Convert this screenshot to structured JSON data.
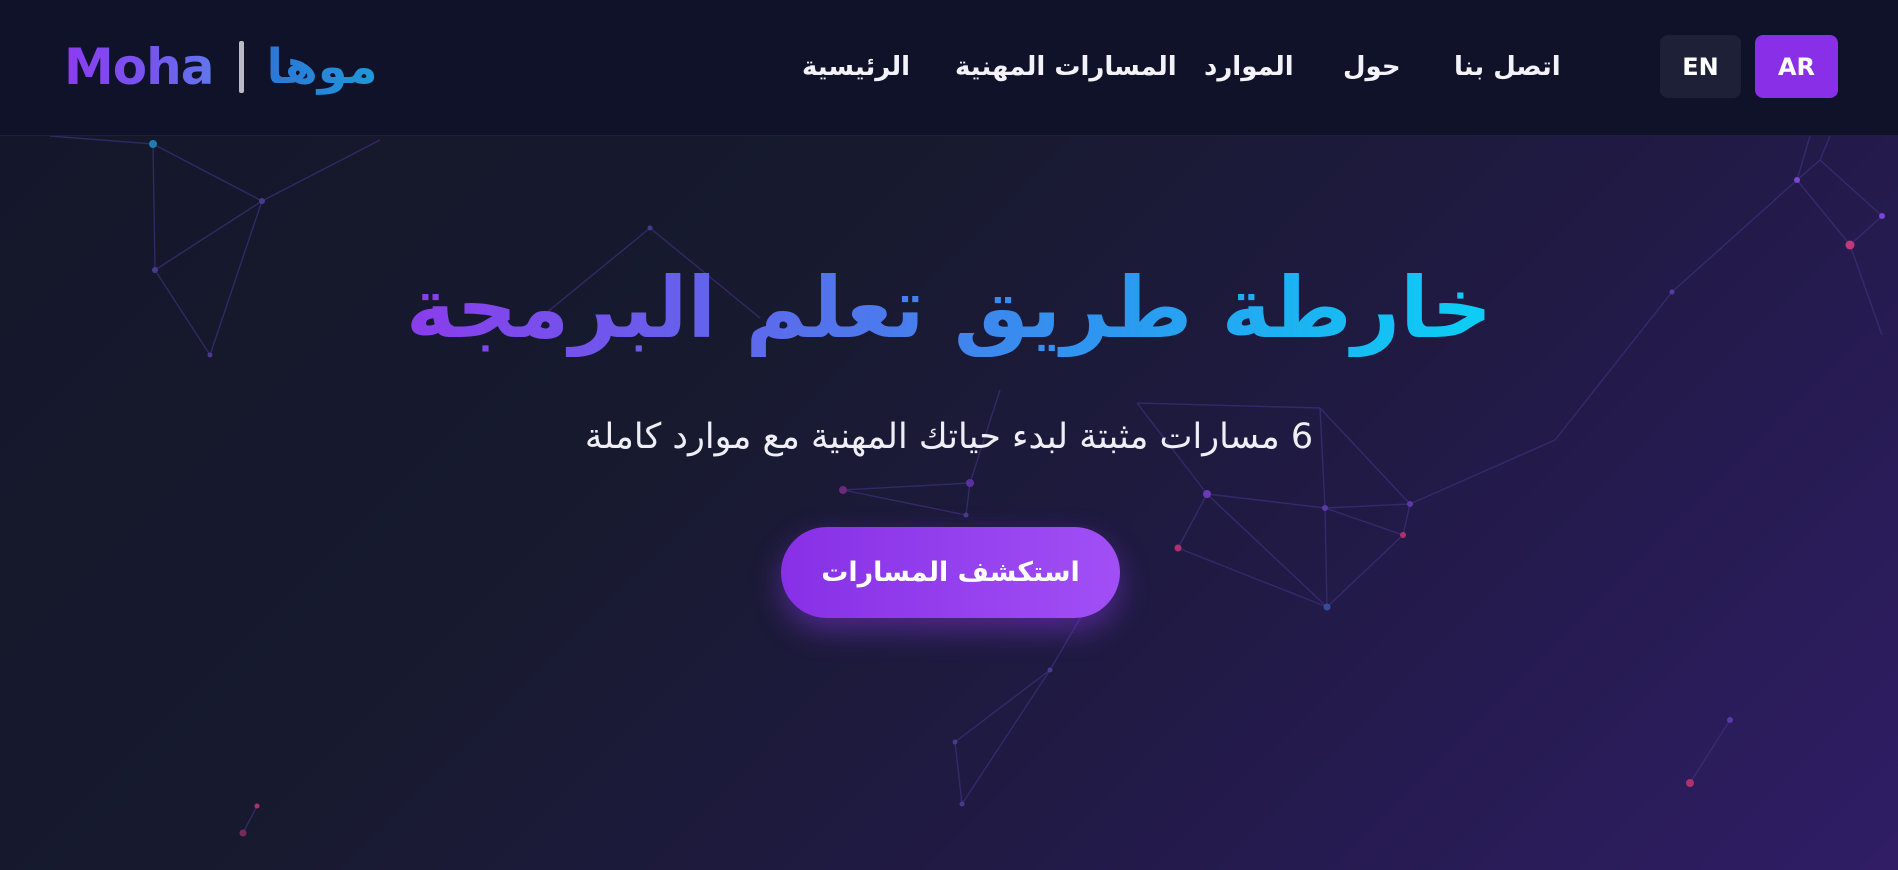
{
  "header": {
    "logo": {
      "text_en": "Moha",
      "text_ar": "موها"
    },
    "nav": [
      {
        "label": "الرئيسية"
      },
      {
        "label": "المسارات المهنية"
      },
      {
        "label": "الموارد"
      },
      {
        "label": "حول"
      },
      {
        "label": "اتصل بنا"
      }
    ],
    "languages": {
      "en": "EN",
      "ar": "AR",
      "active": "AR"
    }
  },
  "hero": {
    "title": "خارطة طريق تعلم البرمجة",
    "subtitle": "6 مسارات مثبتة لبدء حياتك المهنية مع موارد كاملة",
    "cta_label": "استكشف المسارات"
  },
  "colors": {
    "accent_purple": "#8a2fe8",
    "accent_cyan": "#0bd0f5",
    "header_bg": "#10122a"
  }
}
